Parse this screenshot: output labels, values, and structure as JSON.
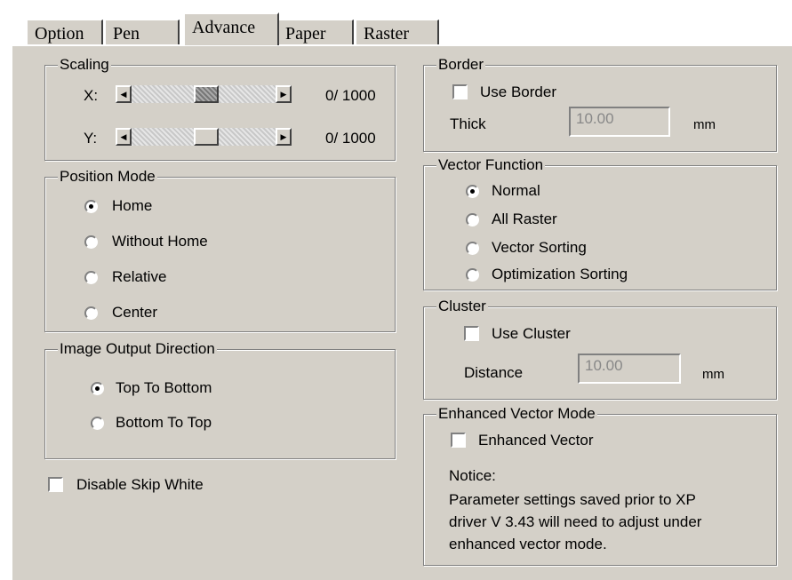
{
  "tabs": [
    {
      "label": "Option"
    },
    {
      "label": "Pen"
    },
    {
      "label": "Advance"
    },
    {
      "label": "Paper"
    },
    {
      "label": "Raster"
    }
  ],
  "active_tab": "Advance",
  "scaling": {
    "title": "Scaling",
    "x_label": "X:",
    "y_label": "Y:",
    "x_value": "0/ 1000",
    "y_value": "0/ 1000"
  },
  "position_mode": {
    "title": "Position Mode",
    "options": [
      "Home",
      "Without Home",
      "Relative",
      "Center"
    ],
    "selected": "Home"
  },
  "image_output_direction": {
    "title": "Image Output Direction",
    "options": [
      "Top To Bottom",
      "Bottom To Top"
    ],
    "selected": "Top To Bottom"
  },
  "disable_skip_white": {
    "label": "Disable Skip White",
    "checked": false
  },
  "border": {
    "title": "Border",
    "use_border_label": "Use Border",
    "use_border_checked": false,
    "thick_label": "Thick",
    "thick_value": "10.00",
    "unit": "mm"
  },
  "vector_function": {
    "title": "Vector Function",
    "options": [
      "Normal",
      "All Raster",
      "Vector Sorting",
      "Optimization Sorting"
    ],
    "selected": "Normal"
  },
  "cluster": {
    "title": "Cluster",
    "use_cluster_label": "Use Cluster",
    "use_cluster_checked": false,
    "distance_label": "Distance",
    "distance_value": "10.00",
    "unit": "mm"
  },
  "enhanced_vector_mode": {
    "title": "Enhanced Vector Mode",
    "checkbox_label": "Enhanced Vector",
    "checked": false,
    "notice_title": "Notice:",
    "notice_lines": [
      "Parameter settings saved prior to XP",
      "driver V 3.43 will need to adjust under",
      "enhanced vector mode."
    ]
  }
}
